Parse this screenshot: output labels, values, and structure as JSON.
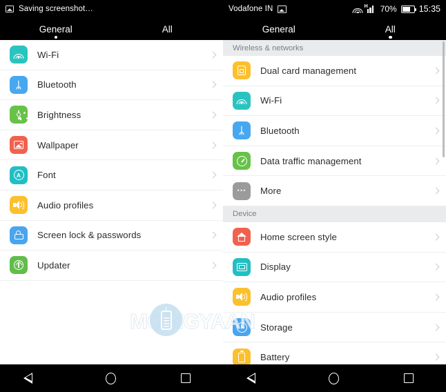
{
  "watermark": {
    "text": "MOBIGYAAN",
    "icon": "mobile-phone-icon"
  },
  "left_panel": {
    "statusbar": {
      "notification_icon": "screenshot-icon",
      "notification_text": "Saving screenshot…"
    },
    "tabs": [
      {
        "label": "General",
        "selected": true
      },
      {
        "label": "All",
        "selected": false
      }
    ],
    "rows": [
      {
        "label": "Wi-Fi",
        "icon": "wifi-icon",
        "color": "#2ac4c0"
      },
      {
        "label": "Bluetooth",
        "icon": "bluetooth-icon",
        "color": "#47a8f0"
      },
      {
        "label": "Brightness",
        "icon": "brightness-icon",
        "color": "#68c247"
      },
      {
        "label": "Wallpaper",
        "icon": "wallpaper-icon",
        "color": "#f2614e"
      },
      {
        "label": "Font",
        "icon": "font-icon",
        "color": "#21bfc4"
      },
      {
        "label": "Audio profiles",
        "icon": "volume-icon",
        "color": "#fbc02d"
      },
      {
        "label": "Screen lock & passwords",
        "icon": "lock-icon",
        "color": "#4aa5ef"
      },
      {
        "label": "Updater",
        "icon": "updater-icon",
        "color": "#62bd4b"
      }
    ],
    "navbar": [
      {
        "name": "back",
        "icon": "back-triangle-icon"
      },
      {
        "name": "home",
        "icon": "home-circle-icon"
      },
      {
        "name": "recents",
        "icon": "recents-square-icon"
      }
    ]
  },
  "right_panel": {
    "statusbar": {
      "carrier": "Vodafone IN",
      "notification_icon": "gallery-icon",
      "wifi_icon": "wifi-icon",
      "network_type": "H",
      "signal_icon": "signal-bars-icon",
      "battery_percent": "70%",
      "battery_icon": "battery-icon",
      "clock": "15:35"
    },
    "tabs": [
      {
        "label": "General",
        "selected": false
      },
      {
        "label": "All",
        "selected": true
      }
    ],
    "groups": [
      {
        "header": "Wireless & networks",
        "rows": [
          {
            "label": "Dual card management",
            "icon": "sim-card-icon",
            "color": "#fbc02d"
          },
          {
            "label": "Wi-Fi",
            "icon": "wifi-icon",
            "color": "#2ac4c0"
          },
          {
            "label": "Bluetooth",
            "icon": "bluetooth-icon",
            "color": "#47a8f0"
          },
          {
            "label": "Data traffic management",
            "icon": "data-gauge-icon",
            "color": "#68c247"
          },
          {
            "label": "More",
            "icon": "more-dots-icon",
            "color": "#9b9b9b"
          }
        ]
      },
      {
        "header": "Device",
        "rows": [
          {
            "label": "Home screen style",
            "icon": "home-icon",
            "color": "#f2614e"
          },
          {
            "label": "Display",
            "icon": "display-icon",
            "color": "#21bfc4"
          },
          {
            "label": "Audio profiles",
            "icon": "volume-icon",
            "color": "#fbc02d"
          },
          {
            "label": "Storage",
            "icon": "storage-icon",
            "color": "#4aa5ef"
          },
          {
            "label": "Battery",
            "icon": "battery-icon",
            "color": "#fbc02d"
          }
        ]
      }
    ],
    "navbar": [
      {
        "name": "back",
        "icon": "back-triangle-icon"
      },
      {
        "name": "home",
        "icon": "home-circle-icon"
      },
      {
        "name": "recents",
        "icon": "recents-square-icon"
      }
    ]
  }
}
